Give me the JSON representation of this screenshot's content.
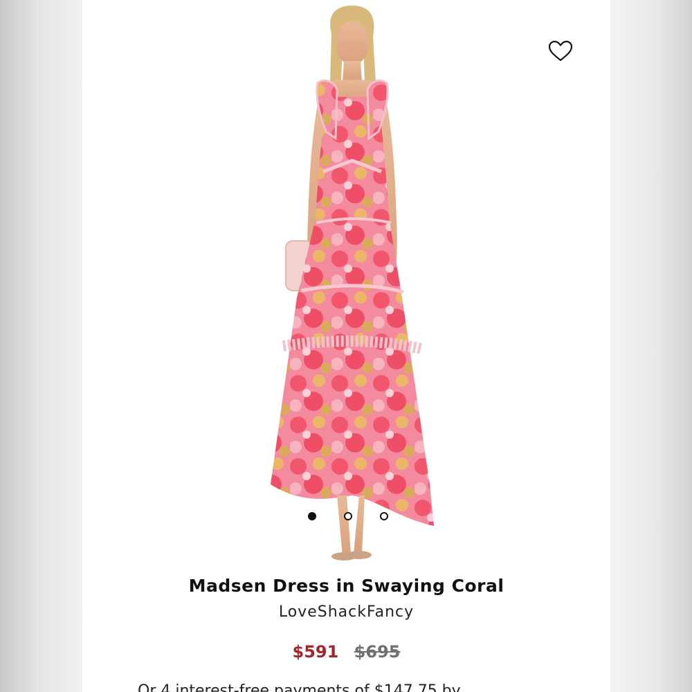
{
  "product": {
    "title": "Madsen Dress in Swaying Coral",
    "brand": "LoveShackFancy",
    "sale_price": "$591",
    "original_price": "$695",
    "installment_text": "Or 4 interest-free payments of $147.75 by"
  },
  "carousel": {
    "total": 3,
    "active_index": 0
  },
  "icons": {
    "wishlist": "heart-outline-icon"
  },
  "colors": {
    "sale_price": "#a4262c",
    "original_price": "#707070",
    "text": "#111111",
    "dress_pink": "#f06a8a",
    "dress_coral": "#f2566c",
    "dress_yellow": "#d8b44a"
  }
}
